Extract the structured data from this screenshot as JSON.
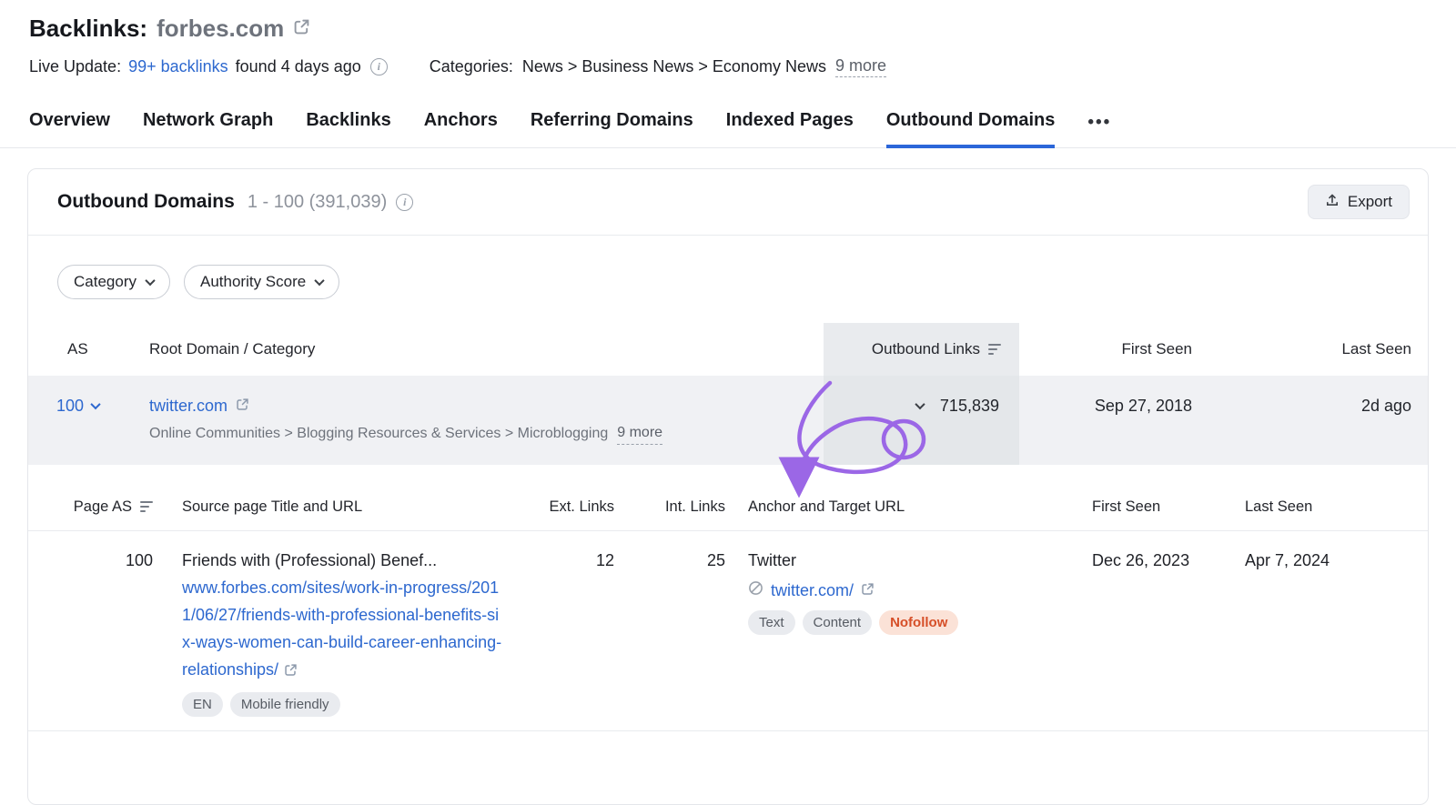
{
  "header": {
    "title": "Backlinks:",
    "domain": "forbes.com",
    "live_update": {
      "label": "Live Update:",
      "link": "99+ backlinks",
      "suffix": "found 4 days ago"
    },
    "categories": {
      "label": "Categories:",
      "path": "News > Business News > Economy News",
      "more": "9 more"
    }
  },
  "tabs": {
    "items": [
      {
        "label": "Overview"
      },
      {
        "label": "Network Graph"
      },
      {
        "label": "Backlinks"
      },
      {
        "label": "Anchors"
      },
      {
        "label": "Referring Domains"
      },
      {
        "label": "Indexed Pages"
      },
      {
        "label": "Outbound Domains"
      }
    ],
    "more_icon": "•••"
  },
  "card": {
    "title": "Outbound Domains",
    "range": "1 - 100 (391,039)",
    "export_label": "Export"
  },
  "filters": {
    "category_label": "Category",
    "authority_label": "Authority Score"
  },
  "main_table": {
    "headers": {
      "as": "AS",
      "root": "Root Domain / Category",
      "outbound": "Outbound Links",
      "first_seen": "First Seen",
      "last_seen": "Last Seen"
    },
    "row": {
      "as": "100",
      "domain": "twitter.com",
      "category_path": "Online Communities > Blogging Resources & Services > Microblogging",
      "category_more": "9 more",
      "outbound_links": "715,839",
      "first_seen": "Sep 27, 2018",
      "last_seen": "2d ago"
    }
  },
  "sub_table": {
    "headers": {
      "page_as": "Page AS",
      "source": "Source page Title and URL",
      "ext": "Ext. Links",
      "int": "Int. Links",
      "anchor": "Anchor and Target URL",
      "first_seen": "First Seen",
      "last_seen": "Last Seen"
    },
    "row": {
      "page_as": "100",
      "title": "Friends with (Professional) Benef...",
      "url": "www.forbes.com/sites/work-in-progress/2011/06/27/friends-with-professional-benefits-six-ways-women-can-build-career-enhancing-relationships/",
      "badges": [
        "EN",
        "Mobile friendly"
      ],
      "ext_links": "12",
      "int_links": "25",
      "anchor_text": "Twitter",
      "target_url": "twitter.com/",
      "link_badges": [
        "Text",
        "Content",
        "Nofollow"
      ],
      "first_seen": "Dec 26, 2023",
      "last_seen": "Apr 7, 2024"
    }
  },
  "icons": {
    "info": "i"
  },
  "colors": {
    "accent_blue": "#2b66d9",
    "link_blue": "#2d68cf",
    "annotation_purple": "#9b67e6",
    "nofollow_bg": "#fbe2d7",
    "nofollow_text": "#d64f28"
  }
}
